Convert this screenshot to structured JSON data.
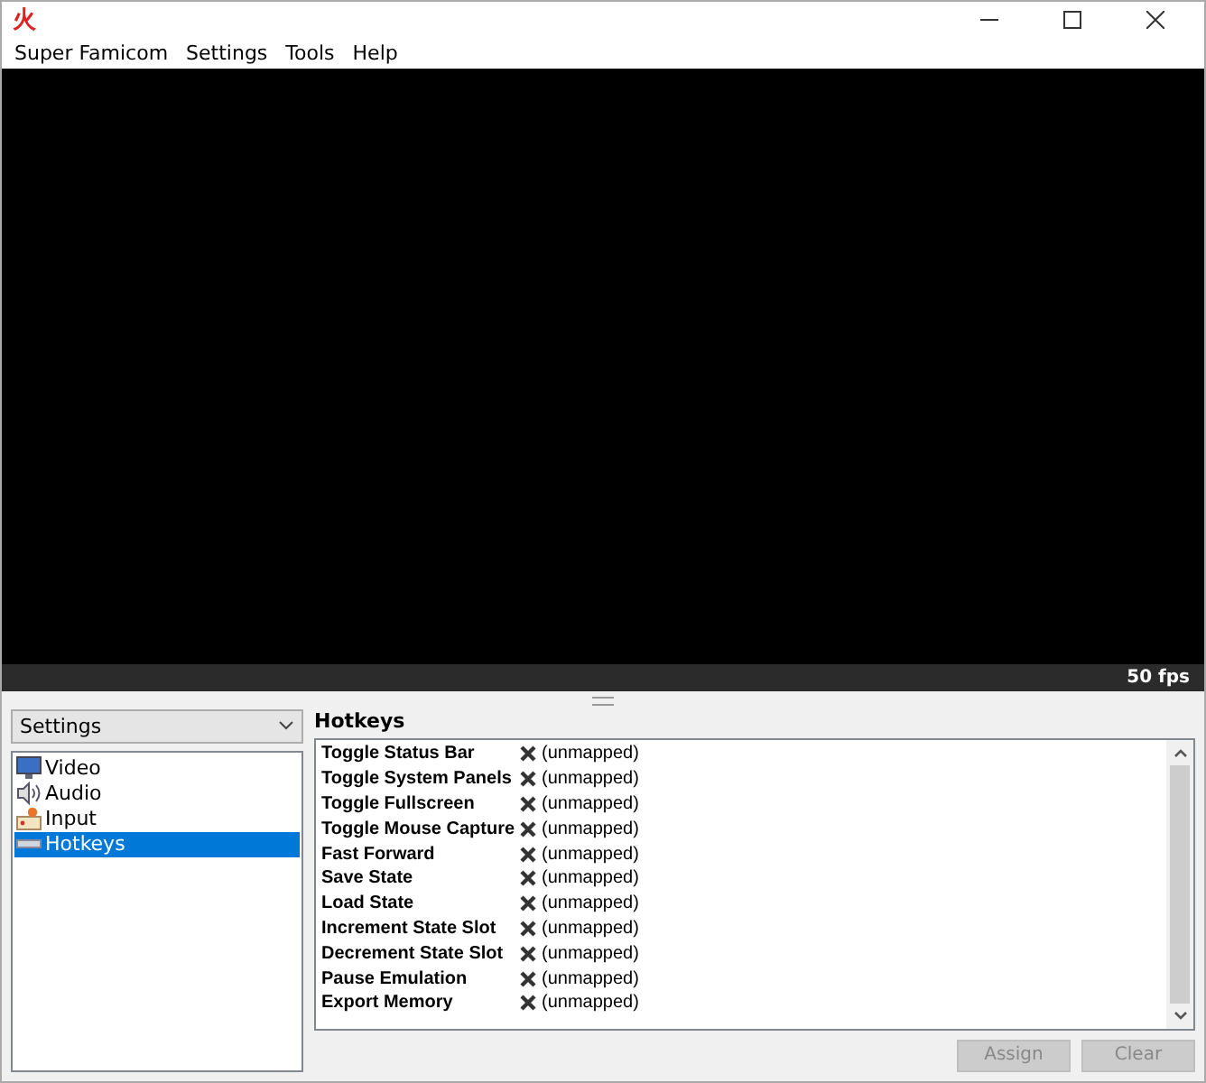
{
  "window": {
    "icon": "火"
  },
  "menu": [
    "Super Famicom",
    "Settings",
    "Tools",
    "Help"
  ],
  "status_bar": {
    "fps": "50 fps"
  },
  "settings_dropdown": {
    "value": "Settings"
  },
  "sidebar": {
    "items": [
      {
        "label": "Video",
        "kind": "video",
        "selected": false
      },
      {
        "label": "Audio",
        "kind": "audio",
        "selected": false
      },
      {
        "label": "Input",
        "kind": "input",
        "selected": false
      },
      {
        "label": "Hotkeys",
        "kind": "hotkeys",
        "selected": true
      }
    ]
  },
  "panel": {
    "title": "Hotkeys"
  },
  "hotkeys": [
    {
      "name": "Toggle Status Bar",
      "mapping": "(unmapped)"
    },
    {
      "name": "Toggle System Panels",
      "mapping": "(unmapped)"
    },
    {
      "name": "Toggle Fullscreen",
      "mapping": "(unmapped)"
    },
    {
      "name": "Toggle Mouse Capture",
      "mapping": "(unmapped)"
    },
    {
      "name": "Fast Forward",
      "mapping": "(unmapped)"
    },
    {
      "name": "Save State",
      "mapping": "(unmapped)"
    },
    {
      "name": "Load State",
      "mapping": "(unmapped)"
    },
    {
      "name": "Increment State Slot",
      "mapping": "(unmapped)"
    },
    {
      "name": "Decrement State Slot",
      "mapping": "(unmapped)"
    },
    {
      "name": "Pause Emulation",
      "mapping": "(unmapped)"
    },
    {
      "name": "Export Memory",
      "mapping": "(unmapped)"
    }
  ],
  "buttons": [
    {
      "label": "Assign",
      "disabled": true
    },
    {
      "label": "Clear",
      "disabled": true
    }
  ]
}
